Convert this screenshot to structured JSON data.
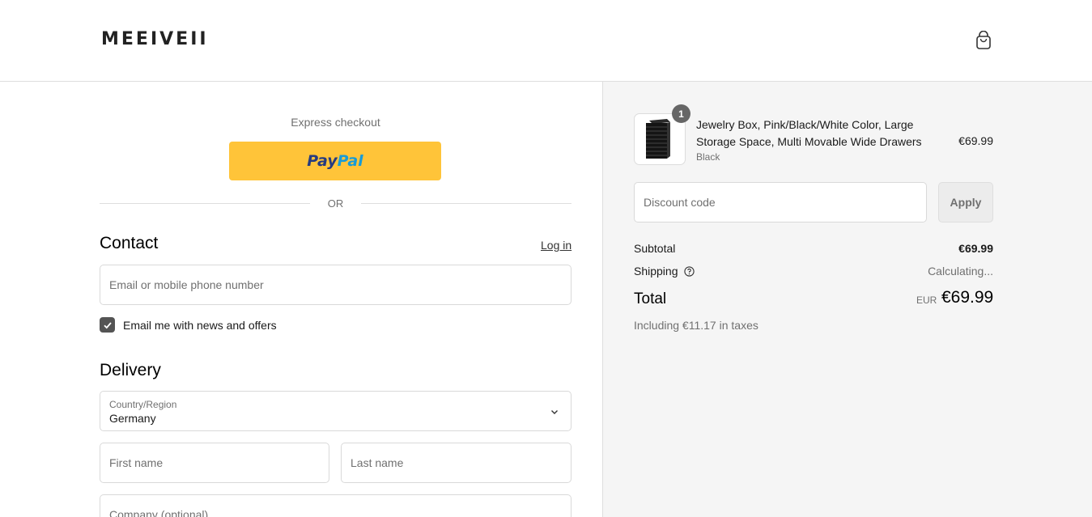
{
  "header": {
    "logo_text": "MEEIVEII",
    "cart_icon": "shopping-bag-icon"
  },
  "express": {
    "label": "Express checkout",
    "paypal_part1": "Pay",
    "paypal_part2": "Pal",
    "paypal_color": "#ffc439",
    "or_text": "OR"
  },
  "contact": {
    "title": "Contact",
    "login_label": "Log in",
    "email_placeholder": "Email or mobile phone number",
    "news_checkbox_label": "Email me with news and offers",
    "news_checked": true
  },
  "delivery": {
    "title": "Delivery",
    "country_label": "Country/Region",
    "country_value": "Germany",
    "first_name_placeholder": "First name",
    "last_name_placeholder": "Last name",
    "company_placeholder": "Company (optional)"
  },
  "summary": {
    "item": {
      "quantity": "1",
      "name": "Jewelry Box, Pink/Black/White Color, Large Storage Space, Multi Movable Wide Drawers",
      "variant": "Black",
      "price": "€69.99"
    },
    "discount_placeholder": "Discount code",
    "apply_label": "Apply",
    "subtotal_label": "Subtotal",
    "subtotal_value": "€69.99",
    "shipping_label": "Shipping",
    "shipping_value": "Calculating...",
    "total_label": "Total",
    "currency": "EUR",
    "total_value": "€69.99",
    "taxes_text": "Including €11.17 in taxes"
  }
}
